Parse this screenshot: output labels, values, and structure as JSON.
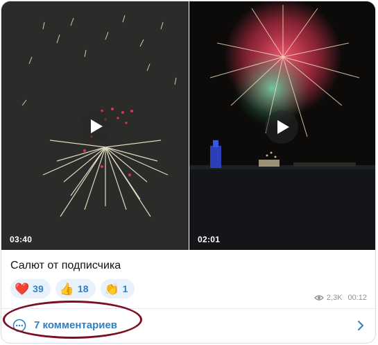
{
  "post": {
    "videos": [
      {
        "duration": "03:40",
        "play_icon": "play-icon"
      },
      {
        "duration": "02:01",
        "play_icon": "play-icon"
      }
    ],
    "caption": "Салют от подписчика",
    "reactions": [
      {
        "emoji": "❤️",
        "count": "39"
      },
      {
        "emoji": "👍",
        "count": "18"
      },
      {
        "emoji": "👏",
        "count": "1"
      }
    ],
    "views": "2,3K",
    "time": "00:12",
    "comments_label": "7 комментариев",
    "colors": {
      "accent": "#2f7fc1",
      "reaction_bg": "#e9f2fb",
      "highlight": "#7a0f24"
    }
  }
}
